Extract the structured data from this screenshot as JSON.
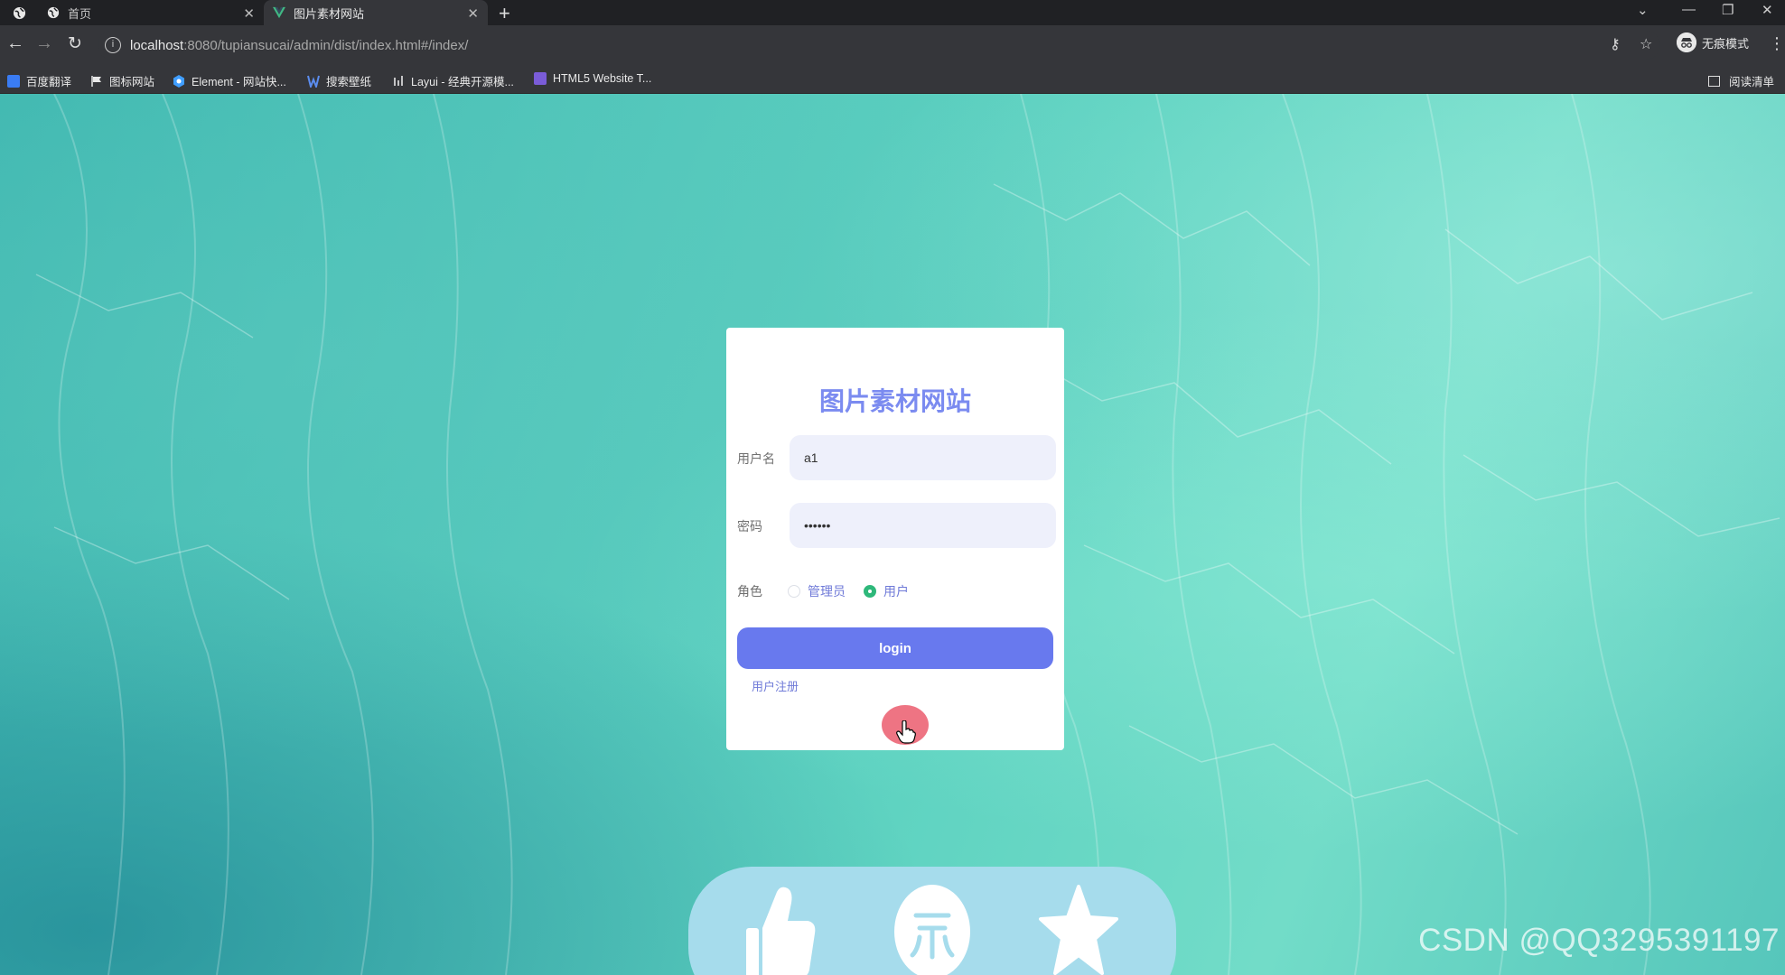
{
  "browser": {
    "tabs": [
      {
        "title": "首页",
        "active": false
      },
      {
        "title": "图片素材网站",
        "active": true
      }
    ],
    "address": {
      "url_host": "localhost",
      "url_rest": ":8080/tupiansucai/admin/dist/index.html#/index/"
    },
    "profile_label": "无痕模式",
    "bookmarks": [
      {
        "label": "百度翻译",
        "icon": "baidu-translate-icon"
      },
      {
        "label": "图标网站",
        "icon": "flag-icon"
      },
      {
        "label": "Element - 网站快...",
        "icon": "element-icon"
      },
      {
        "label": "搜索壁纸",
        "icon": "wallpaper-icon"
      },
      {
        "label": "Layui - 经典开源模...",
        "icon": "layui-icon"
      },
      {
        "label": "HTML5 Website T...",
        "icon": "html5-icon"
      }
    ],
    "reading_list": "阅读清单"
  },
  "login": {
    "title": "图片素材网站",
    "username_label": "用户名",
    "username_value": "a1",
    "password_label": "密码",
    "password_value": "••••••",
    "role_label": "角色",
    "roles": [
      {
        "label": "管理员",
        "checked": false
      },
      {
        "label": "用户",
        "checked": true
      }
    ],
    "login_button": "login",
    "register_link": "用户注册"
  },
  "action_bar": {
    "icons": [
      "thumbs-up-icon",
      "coin-icon",
      "star-icon"
    ]
  },
  "watermark": "CSDN @QQ3295391197",
  "colors": {
    "title": "#7b8bf0",
    "button": "#6879ee",
    "radio_checked": "#2eb87a",
    "input_bg": "#eef0fb",
    "action_bar": "#a6dcec"
  }
}
